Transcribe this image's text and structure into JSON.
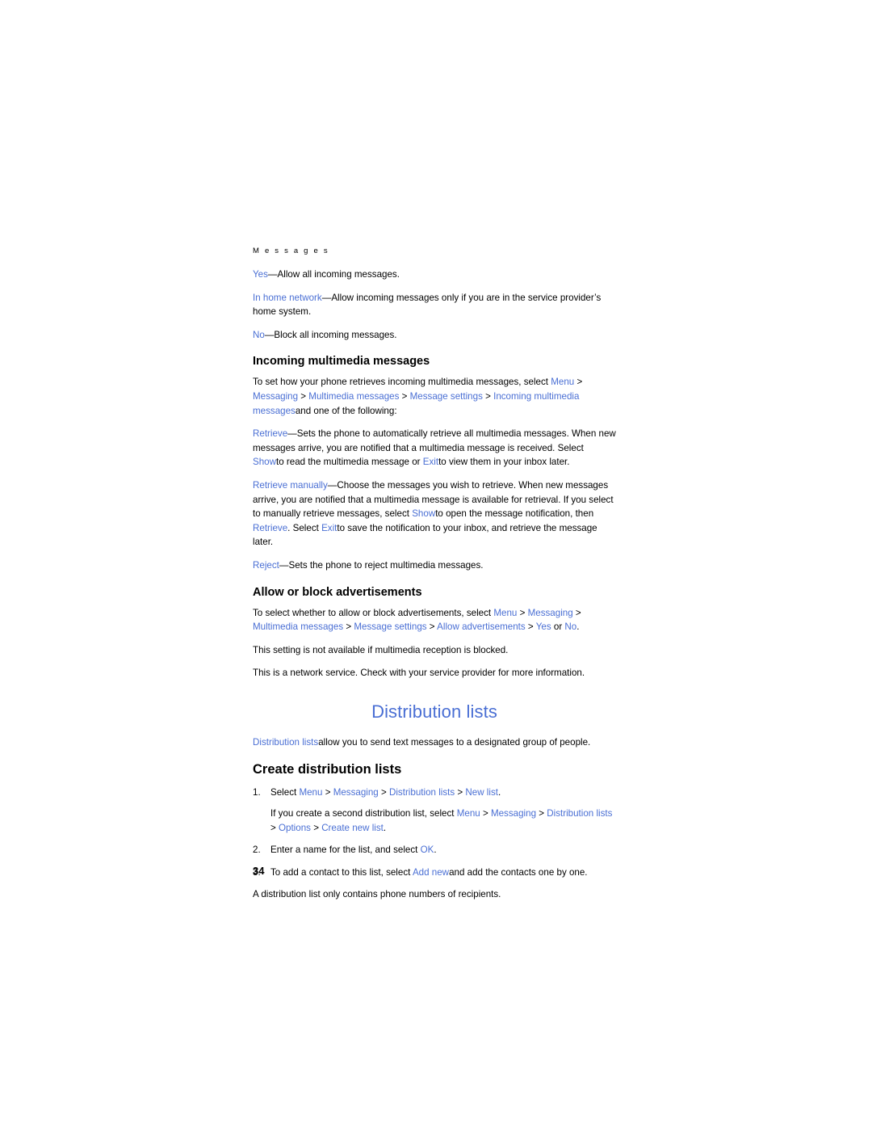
{
  "running_head": "M e s s a g e s",
  "page_number": "34",
  "paragraphs": {
    "yes_allow": {
      "blue1": "Yes",
      "rest": "—Allow all incoming messages."
    },
    "in_home": {
      "blue1": "In home network",
      "rest": "—Allow incoming messages only if you are in the service provider’s home system."
    },
    "no_block": {
      "blue1": "No",
      "rest": "—Block all incoming messages."
    }
  },
  "incoming_mms": {
    "heading": "Incoming multimedia messages",
    "intro_pre": "To set how your phone retrieves incoming multimedia messages, select ",
    "path": [
      "Menu",
      "Messaging",
      "Multimedia messages",
      "Message settings",
      "Incoming multimedia messages"
    ],
    "intro_post": "and one of the following:",
    "retrieve": {
      "term": "Retrieve",
      "text1": "—Sets the phone to automatically retrieve all multimedia messages. When new messages arrive, you are notified that a multimedia message is received. Select ",
      "term2": "Show",
      "text2": "to read the multimedia message or ",
      "term3": "Exit",
      "text3": "to view them in your inbox later."
    },
    "retrieve_manually": {
      "term": "Retrieve manually",
      "text1": "—Choose the messages you wish to retrieve. When new messages arrive, you are notified that a multimedia message is available for retrieval. If you select to manually retrieve messages, select ",
      "term2": "Show",
      "text2": "to open the message notification, then ",
      "term3": "Retrieve",
      "text3": ". Select ",
      "term4": "Exit",
      "text4": "to save the notification to your inbox, and retrieve the message later."
    },
    "reject": {
      "term": "Reject",
      "text": "—Sets the phone to reject multimedia messages."
    }
  },
  "advertisements": {
    "heading": "Allow or block advertisements",
    "intro_pre": "To select whether to allow or block advertisements, select ",
    "path": [
      "Menu",
      "Messaging",
      "Multimedia messages",
      "Message settings",
      "Allow advertisements"
    ],
    "mid": " > ",
    "option1": "Yes",
    "or": "or",
    "option2": "No",
    "note1": "This setting is not available if multimedia reception is blocked.",
    "note2": "This is a network service. Check with your service provider for more information."
  },
  "distribution": {
    "section_title": "Distribution lists",
    "intro_term": "Distribution lists",
    "intro_text": "allow you to send text messages to a designated group of people.",
    "create_heading": "Create distribution lists",
    "steps": [
      {
        "num": "1.",
        "pre": "Select ",
        "path": [
          "Menu",
          "Messaging",
          "Distribution lists",
          "New list"
        ],
        "post": "",
        "sub_pre": "If you create a second distribution list, select ",
        "sub_path": [
          "Menu",
          "Messaging",
          "Distribution lists",
          "Options",
          "Create new list"
        ]
      },
      {
        "num": "2.",
        "pre": "Enter a name for the list, and select ",
        "term": "OK",
        "post": ""
      },
      {
        "num": "3.",
        "pre": "To add a contact to this list, select ",
        "term": "Add new",
        "post": "and add the contacts one by one."
      }
    ],
    "footer_note": "A distribution list only contains phone numbers of recipients."
  },
  "colors": {
    "link_blue": "#4a6fd4",
    "heading_blue": "#4a6fd4",
    "text_black": "#000000"
  }
}
